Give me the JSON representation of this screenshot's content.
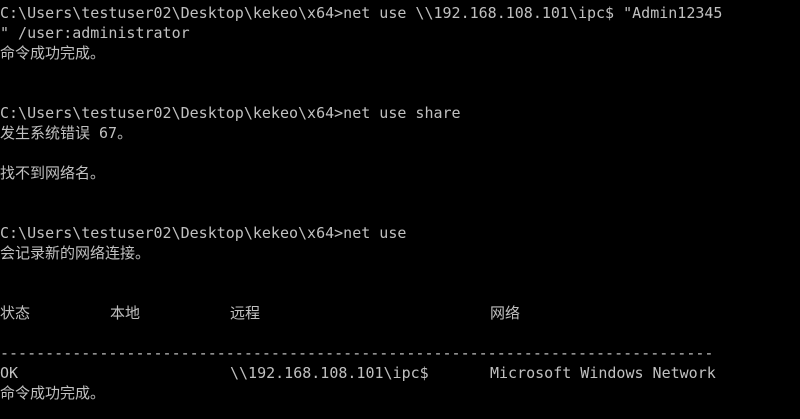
{
  "terminal": {
    "lines": [
      "C:\\Users\\testuser02\\Desktop\\kekeo\\x64>net use \\\\192.168.108.101\\ipc$ \"Admin12345",
      "\" /user:administrator",
      "命令成功完成。",
      "",
      "",
      "C:\\Users\\testuser02\\Desktop\\kekeo\\x64>net use share",
      "发生系统错误 67。",
      "",
      "找不到网络名。",
      "",
      "",
      "C:\\Users\\testuser02\\Desktop\\kekeo\\x64>net use",
      "会记录新的网络连接。"
    ],
    "table": {
      "headers": [
        "状态",
        "本地",
        "远程",
        "网络"
      ],
      "separator": "-------------------------------------------------------------------------------",
      "row": [
        "OK",
        "",
        "\\\\192.168.108.101\\ipc$",
        "Microsoft Windows Network"
      ],
      "footer": "命令成功完成。"
    }
  }
}
